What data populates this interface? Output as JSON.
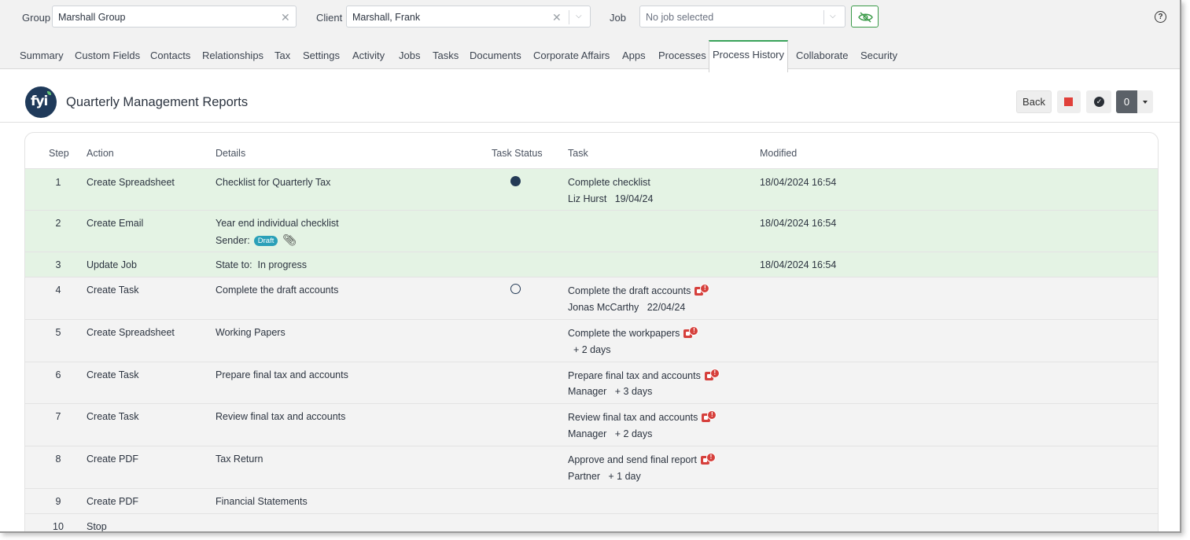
{
  "topbar": {
    "group_label": "Group",
    "group_value": "Marshall Group",
    "client_label": "Client",
    "client_value": "Marshall, Frank",
    "job_label": "Job",
    "job_placeholder": "No job selected",
    "help_glyph": "?",
    "accent_color": "#3a9a48"
  },
  "tabs": [
    {
      "label": "Summary"
    },
    {
      "label": "Custom Fields"
    },
    {
      "label": "Contacts"
    },
    {
      "label": "Relationships"
    },
    {
      "label": "Tax"
    },
    {
      "label": "Settings"
    },
    {
      "label": "Activity"
    },
    {
      "label": "Jobs"
    },
    {
      "label": "Tasks"
    },
    {
      "label": "Documents"
    },
    {
      "label": "Corporate Affairs"
    },
    {
      "label": "Apps"
    },
    {
      "label": "Processes"
    },
    {
      "label": "Process History",
      "active": true
    },
    {
      "label": "Collaborate"
    },
    {
      "label": "Security"
    }
  ],
  "header": {
    "logo_text": "fyi",
    "title": "Quarterly Management Reports",
    "back_label": "Back",
    "count": "0"
  },
  "table": {
    "columns": [
      "Step",
      "Action",
      "Details",
      "Task Status",
      "Task",
      "Modified"
    ],
    "rows": [
      {
        "step": "1",
        "action": "Create Spreadsheet",
        "details": "Checklist for Quarterly Tax",
        "status": "filled",
        "task": "Complete checklist",
        "task_sub": "Liz Hurst   19/04/24",
        "modified": "18/04/2024 16:54",
        "done": true
      },
      {
        "step": "2",
        "action": "Create Email",
        "details": "Year end individual checklist",
        "details_sub": "Sender:",
        "badge": "Draft",
        "modified": "18/04/2024 16:54",
        "done": true
      },
      {
        "step": "3",
        "action": "Update Job",
        "details": "State to:  In progress",
        "modified": "18/04/2024 16:54",
        "done": true
      },
      {
        "step": "4",
        "action": "Create Task",
        "details": "Complete the draft accounts",
        "status": "empty",
        "task": "Complete the draft accounts",
        "task_sub": "Jonas McCarthy   22/04/24",
        "task_icon": true
      },
      {
        "step": "5",
        "action": "Create Spreadsheet",
        "details": "Working Papers",
        "task": "Complete the workpapers",
        "task_sub": "  + 2 days",
        "task_icon": true
      },
      {
        "step": "6",
        "action": "Create Task",
        "details": "Prepare final tax and accounts",
        "task": "Prepare final tax and accounts",
        "task_sub": "Manager   + 3 days",
        "task_icon": true
      },
      {
        "step": "7",
        "action": "Create Task",
        "details": "Review final tax and accounts",
        "task": "Review final tax and accounts",
        "task_sub": "Manager   + 2 days",
        "task_icon": true
      },
      {
        "step": "8",
        "action": "Create PDF",
        "details": "Tax Return",
        "task": "Approve and send final report",
        "task_sub": "Partner   + 1 day",
        "task_icon": true
      },
      {
        "step": "9",
        "action": "Create PDF",
        "details": "Financial Statements"
      },
      {
        "step": "10",
        "action": "Stop"
      }
    ]
  }
}
